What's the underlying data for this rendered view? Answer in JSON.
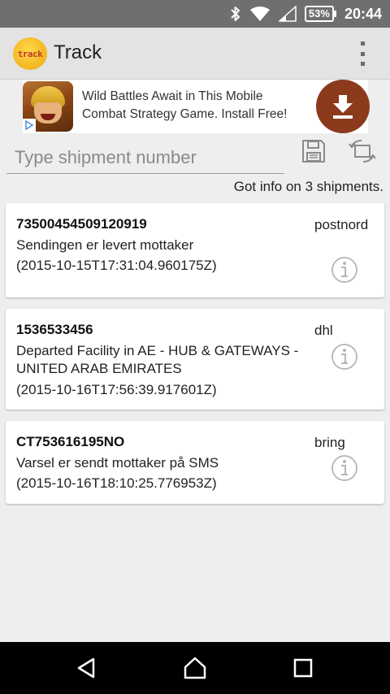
{
  "status_bar": {
    "battery_percent": "53%",
    "time": "20:44",
    "icons": [
      "bluetooth-icon",
      "wifi-icon",
      "cell-signal-icon",
      "battery-icon"
    ]
  },
  "app_bar": {
    "logo_text": "track",
    "title": "Track",
    "menu_icon": "overflow-menu-icon"
  },
  "ad": {
    "text": "Wild Battles Await in This Mobile Combat Strategy Game. Install Free!",
    "install_icon": "download-icon",
    "choices_icon": "ad-choices-icon"
  },
  "search": {
    "placeholder": "Type shipment number",
    "value": ""
  },
  "toolbar_icons": [
    "save-icon",
    "refresh-icon"
  ],
  "summary": "Got info on 3 shipments.",
  "shipments": [
    {
      "number": "73500454509120919",
      "status": "Sendingen er levert mottaker",
      "timestamp": "(2015-10-15T17:31:04.960175Z)",
      "carrier": "postnord"
    },
    {
      "number": "1536533456",
      "status": "Departed Facility in  AE - HUB & GATEWAYS - UNITED ARAB EMIRATES",
      "timestamp": "(2015-10-16T17:56:39.917601Z)",
      "carrier": "dhl"
    },
    {
      "number": "CT753616195NO",
      "status": "Varsel er sendt mottaker på SMS",
      "timestamp": "(2015-10-16T18:10:25.776953Z)",
      "carrier": "bring"
    }
  ],
  "nav": [
    "back-icon",
    "home-icon",
    "recents-icon"
  ],
  "colors": {
    "status_bar": "#6f6f6f",
    "app_bar": "#e3e3e3",
    "background": "#eeeeee",
    "ad_install": "#8b3a1c",
    "logo": "#f3b61f"
  }
}
